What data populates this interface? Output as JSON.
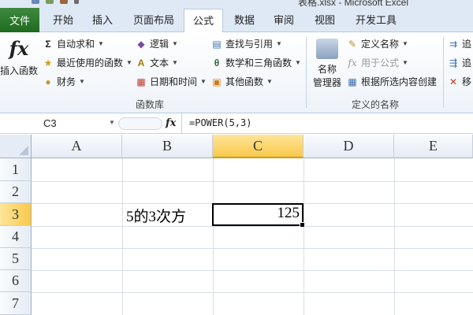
{
  "titlebar": {
    "title": "表格.xlsx - Microsoft Excel"
  },
  "tabs": {
    "file": "文件",
    "items": [
      "开始",
      "插入",
      "页面布局",
      "公式",
      "数据",
      "审阅",
      "视图",
      "开发工具"
    ],
    "active": "公式"
  },
  "ribbon": {
    "insert_function": {
      "icon": "fx",
      "label": "插入函数"
    },
    "library": {
      "autosum": "自动求和",
      "recent": "最近使用的函数",
      "financial": "财务",
      "logical": "逻辑",
      "text": "文本",
      "datetime": "日期和时间",
      "lookup": "查找与引用",
      "math": "数学和三角函数",
      "other": "其他函数",
      "group_label": "函数库"
    },
    "defined_names": {
      "name_manager_l1": "名称",
      "name_manager_l2": "管理器",
      "define_name": "定义名称",
      "use_in_formula": "用于公式",
      "create_from_selection": "根据所选内容创建",
      "group_label": "定义的名称"
    },
    "audit": {
      "trace1": "追",
      "trace2": "追",
      "remove": "移"
    }
  },
  "formula_bar": {
    "name_box": "C3",
    "fx": "fx",
    "formula": "=POWER(5,3)"
  },
  "grid": {
    "columns": [
      "A",
      "B",
      "C",
      "D",
      "E"
    ],
    "rows": [
      "1",
      "2",
      "3",
      "4",
      "5",
      "6",
      "7"
    ],
    "selected_column": "C",
    "selected_row": "3",
    "cells": {
      "B3": "5的3次方",
      "C3": "125"
    }
  },
  "colors": {
    "file_tab": "#2a7a2a",
    "selection_header": "#f8c94b",
    "ribbon_bg": "#dfe9f5"
  }
}
